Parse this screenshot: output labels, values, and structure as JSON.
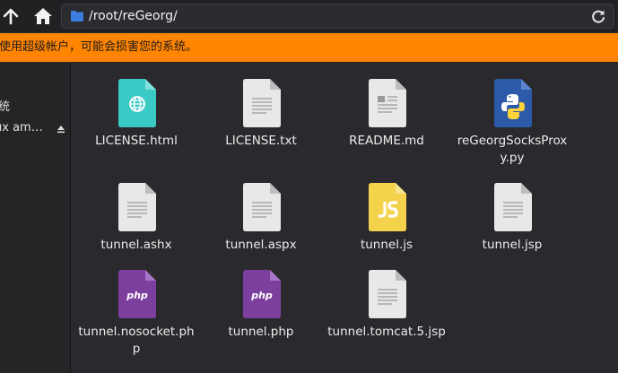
{
  "location": {
    "path": "/root/reGeorg/"
  },
  "warning": {
    "text": "在使用超级帐户，可能会损害您的系统。"
  },
  "sidebar": {
    "items": [
      {
        "label": "统"
      },
      {
        "label": "ux am…"
      }
    ]
  },
  "files": [
    {
      "name": "LICENSE.html",
      "icon": "html-file-icon"
    },
    {
      "name": "LICENSE.txt",
      "icon": "text-file-icon"
    },
    {
      "name": "README.md",
      "icon": "markdown-file-icon"
    },
    {
      "name": "reGeorgSocksProxy.py",
      "icon": "python-file-icon"
    },
    {
      "name": "tunnel.ashx",
      "icon": "text-file-icon"
    },
    {
      "name": "tunnel.aspx",
      "icon": "text-file-icon"
    },
    {
      "name": "tunnel.js",
      "icon": "javascript-file-icon"
    },
    {
      "name": "tunnel.jsp",
      "icon": "text-file-icon"
    },
    {
      "name": "tunnel.nosocket.php",
      "icon": "php-file-icon"
    },
    {
      "name": "tunnel.php",
      "icon": "php-file-icon"
    },
    {
      "name": "tunnel.tomcat.5.jsp",
      "icon": "text-file-icon"
    }
  ],
  "colors": {
    "warning": "#ff8400",
    "html": "#3bc9c6",
    "python": "#2c5aa8",
    "javascript": "#f5d24b",
    "php": "#7d3f9e"
  }
}
